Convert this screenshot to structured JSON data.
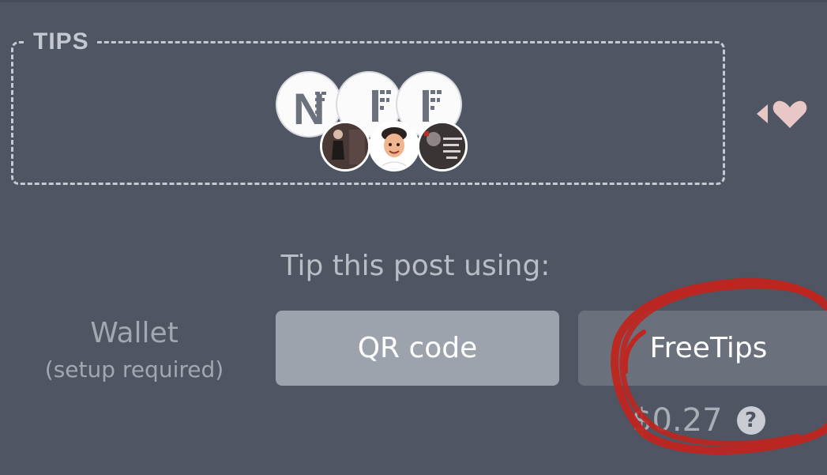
{
  "tips": {
    "title": "TIPS",
    "badge_letter": "N",
    "badges": [
      "nft-badge",
      "nft-badge",
      "nft-badge"
    ],
    "avatars": [
      "user-avatar-photo",
      "user-avatar-memoji",
      "user-avatar-photo-text"
    ]
  },
  "tip_section": {
    "heading": "Tip this post using:",
    "wallet_label": "Wallet",
    "wallet_note": "(setup required)",
    "qr_button": "QR code",
    "freetips_button": "FreeTips",
    "balance": "$0.27",
    "help_icon": "?"
  },
  "colors": {
    "background": "#4f5562",
    "qr_button": "#9da3ad",
    "freetips_button": "#6a707c",
    "heart": "#e8c8c6",
    "annotation": "#c0251f"
  }
}
